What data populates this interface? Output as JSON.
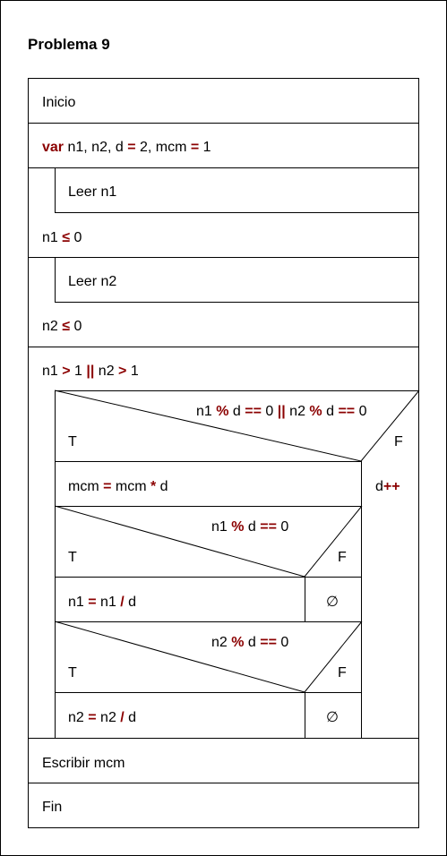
{
  "title": "Problema 9",
  "nodes": {
    "inicio": "Inicio",
    "var_kw": "var",
    "var_rest_a": "n1, n2, d ",
    "eq": "=",
    "var_rest_b": " 2, mcm ",
    "var_rest_c": " 1",
    "leer_n1": "Leer n1",
    "cond_n1_a": "n1 ",
    "le": "≤",
    "cond_n1_b": " 0",
    "leer_n2": "Leer n2",
    "cond_n2_a": "n2 ",
    "cond_n2_b": " 0",
    "while_a": "n1 ",
    "gt": ">",
    "while_b": " 1 ",
    "or": "||",
    "while_c": " n2 ",
    "while_d": " 1",
    "if1_a": "n1 ",
    "mod": "%",
    "if1_b": " d ",
    "eqeq": "==",
    "if1_c": " 0 ",
    "if1_d": " n2 ",
    "if1_e": " d ",
    "if1_f": " 0",
    "true_label": "T",
    "false_label": "F",
    "mcm_a": "mcm ",
    "mcm_b": " mcm ",
    "mul": "*",
    "mcm_c": " d",
    "dinc_a": "d",
    "inc": "++",
    "if2_a": "n1 ",
    "if2_b": " d ",
    "if2_c": " 0",
    "div_n1_a": "n1 ",
    "div_n1_b": " n1 ",
    "div": "/",
    "div_n1_c": " d",
    "empty": "∅",
    "if3_a": "n2 ",
    "if3_b": " d ",
    "if3_c": " 0",
    "div_n2_a": "n2 ",
    "div_n2_b": " n2 ",
    "div_n2_c": " d",
    "escribir": "Escribir mcm",
    "fin": "Fin"
  }
}
